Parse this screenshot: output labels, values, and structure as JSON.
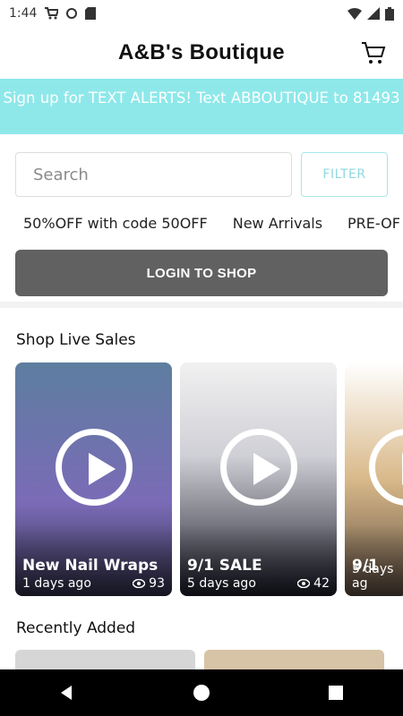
{
  "status_bar": {
    "time": "1:44"
  },
  "header": {
    "title": "A&B's Boutique"
  },
  "banner": {
    "text": "Sign up for TEXT ALERTS! Text ABBOUTIQUE to 81493"
  },
  "search": {
    "placeholder": "Search",
    "filter_label": "FILTER"
  },
  "chips": [
    {
      "label": "50%OFF with code 50OFF"
    },
    {
      "label": "New Arrivals"
    },
    {
      "label": "PRE-OF"
    }
  ],
  "login": {
    "label": "LOGIN TO SHOP"
  },
  "live_sales": {
    "title": "Shop Live Sales",
    "cards": [
      {
        "name": "New Nail Wraps",
        "ago": "1 days ago",
        "views": "93",
        "bg": "#6f6aa6"
      },
      {
        "name": "9/1 SALE",
        "ago": "5 days ago",
        "views": "42",
        "bg": "#d8d8d8"
      },
      {
        "name": "9/1",
        "ago": "5 days ag",
        "views": "",
        "bg": "#c7a676"
      }
    ]
  },
  "recent": {
    "title": "Recently Added"
  },
  "colors": {
    "accent": "#8ee8ea",
    "button": "#616161"
  },
  "icons": {
    "cart": "shopping-cart-icon",
    "filter": "filter-button",
    "play": "play-icon",
    "eye": "eye-icon",
    "nav_back": "back-icon",
    "nav_home": "home-icon",
    "nav_recent": "recent-apps-icon"
  }
}
